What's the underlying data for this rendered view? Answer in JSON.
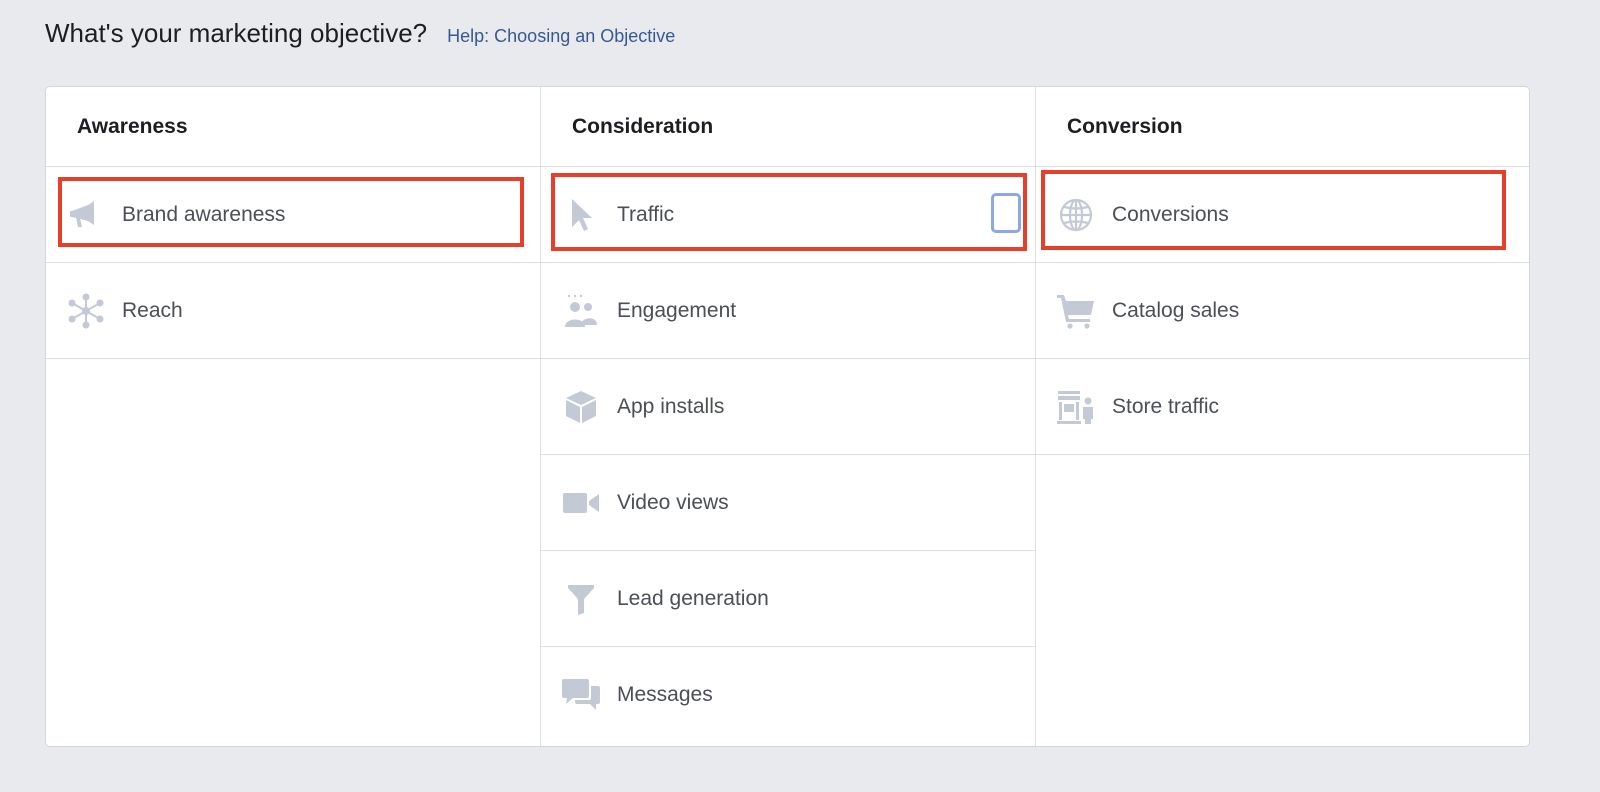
{
  "header": {
    "title": "What's your marketing objective?",
    "help_link": "Help: Choosing an Objective"
  },
  "columns": [
    {
      "title": "Awareness",
      "options": [
        {
          "label": "Brand awareness",
          "icon": "megaphone-icon",
          "highlighted": true
        },
        {
          "label": "Reach",
          "icon": "reach-network-icon",
          "highlighted": false
        }
      ]
    },
    {
      "title": "Consideration",
      "options": [
        {
          "label": "Traffic",
          "icon": "cursor-icon",
          "highlighted": true
        },
        {
          "label": "Engagement",
          "icon": "people-icon",
          "highlighted": false
        },
        {
          "label": "App installs",
          "icon": "box-icon",
          "highlighted": false
        },
        {
          "label": "Video views",
          "icon": "video-camera-icon",
          "highlighted": false
        },
        {
          "label": "Lead generation",
          "icon": "funnel-icon",
          "highlighted": false
        },
        {
          "label": "Messages",
          "icon": "chat-bubbles-icon",
          "highlighted": false
        }
      ]
    },
    {
      "title": "Conversion",
      "options": [
        {
          "label": "Conversions",
          "icon": "globe-icon",
          "highlighted": true
        },
        {
          "label": "Catalog sales",
          "icon": "shopping-cart-icon",
          "highlighted": false
        },
        {
          "label": "Store traffic",
          "icon": "storefront-icon",
          "highlighted": false
        }
      ]
    }
  ],
  "colors": {
    "background": "#e9eaed",
    "icon": "#c4c9d6",
    "highlight": "#e6402a",
    "link": "#365899",
    "focus": "#8aa8e8"
  }
}
